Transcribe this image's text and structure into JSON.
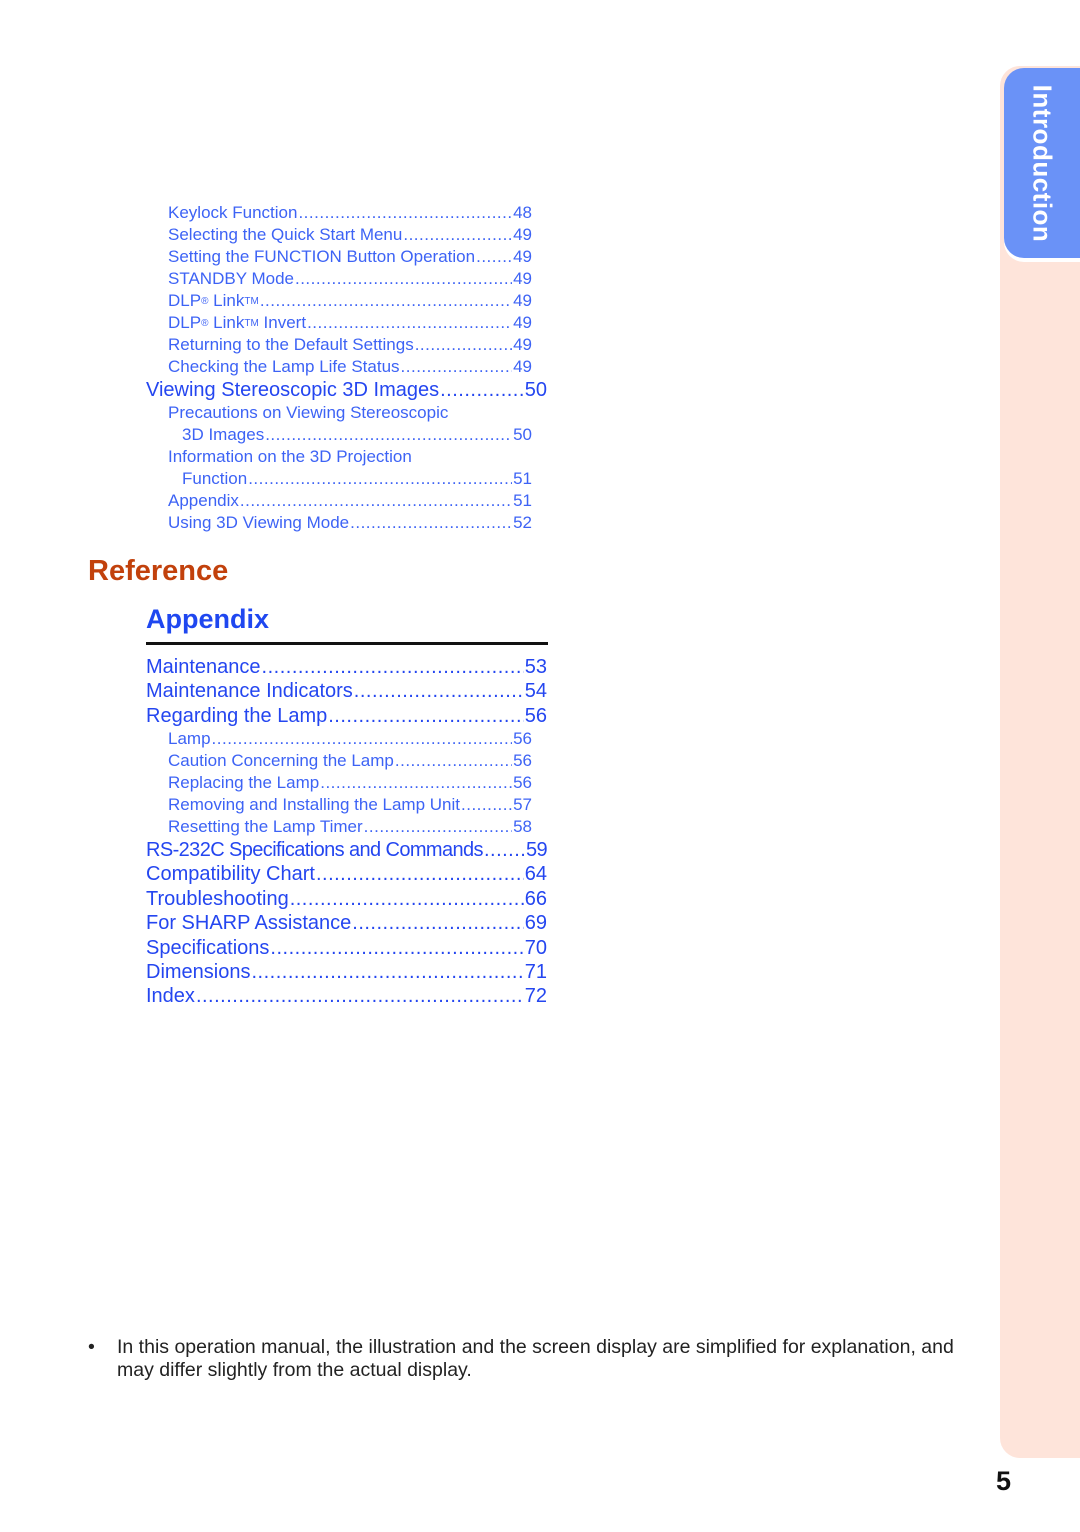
{
  "side_tab": {
    "label": "Introduction",
    "colors": {
      "tab": "#6a92f7",
      "strip": "#fee4da"
    }
  },
  "toc_continued": [
    {
      "title": "Keylock Function",
      "page": "48",
      "level": 2
    },
    {
      "title": "Selecting the Quick Start Menu",
      "page": "49",
      "level": 2
    },
    {
      "title": "Setting the FUNCTION Button Operation",
      "page": "49",
      "level": 2
    },
    {
      "title": "STANDBY Mode",
      "page": "49",
      "level": 2
    },
    {
      "title": "DLP",
      "sup1": "®",
      "title_b": " Link",
      "sup2": "TM",
      "page": "49",
      "level": 2
    },
    {
      "title": "DLP",
      "sup1": "®",
      "title_b": " Link",
      "sup2": "TM",
      "title_c": " Invert",
      "page": "49",
      "level": 2
    },
    {
      "title": "Returning to the Default Settings",
      "page": "49",
      "level": 2
    },
    {
      "title": "Checking the Lamp Life Status",
      "page": "49",
      "level": 2
    },
    {
      "title": "Viewing Stereoscopic 3D Images",
      "page": "50",
      "level": 1
    },
    {
      "title": "Precautions on Viewing Stereoscopic",
      "title_cont": "3D Images",
      "page": "50",
      "level": 2
    },
    {
      "title": "Information on the 3D Projection",
      "title_cont": "Function",
      "page": "51",
      "level": 2
    },
    {
      "title": "Appendix",
      "page": "51",
      "level": 2
    },
    {
      "title": "Using 3D Viewing Mode",
      "page": "52",
      "level": 2
    }
  ],
  "reference": {
    "heading": "Reference",
    "section_heading": "Appendix",
    "entries": [
      {
        "title": "Maintenance",
        "page": "53",
        "level": 1
      },
      {
        "title": "Maintenance Indicators",
        "page": "54",
        "level": 1
      },
      {
        "title": "Regarding the Lamp",
        "page": "56",
        "level": 1
      },
      {
        "title": "Lamp",
        "page": "56",
        "level": 2
      },
      {
        "title": "Caution Concerning the Lamp",
        "page": "56",
        "level": 2
      },
      {
        "title": "Replacing the Lamp",
        "page": "56",
        "level": 2
      },
      {
        "title": "Removing and Installing the Lamp Unit",
        "page": "57",
        "level": 2
      },
      {
        "title": "Resetting the Lamp Timer",
        "page": "58",
        "level": 2
      },
      {
        "title": "RS-232C Specifications and Commands",
        "page": "59",
        "level": 1
      },
      {
        "title": "Compatibility Chart",
        "page": "64",
        "level": 1
      },
      {
        "title": "Troubleshooting",
        "page": "66",
        "level": 1
      },
      {
        "title": "For SHARP Assistance",
        "page": "69",
        "level": 1
      },
      {
        "title": "Specifications",
        "page": "70",
        "level": 1
      },
      {
        "title": "Dimensions",
        "page": "71",
        "level": 1
      },
      {
        "title": "Index",
        "page": "72",
        "level": 1
      }
    ]
  },
  "note": {
    "bullet": "•",
    "text": "In this operation manual, the illustration and the screen display are simplified for explanation, and may differ slightly from the actual display."
  },
  "page_number": "5"
}
